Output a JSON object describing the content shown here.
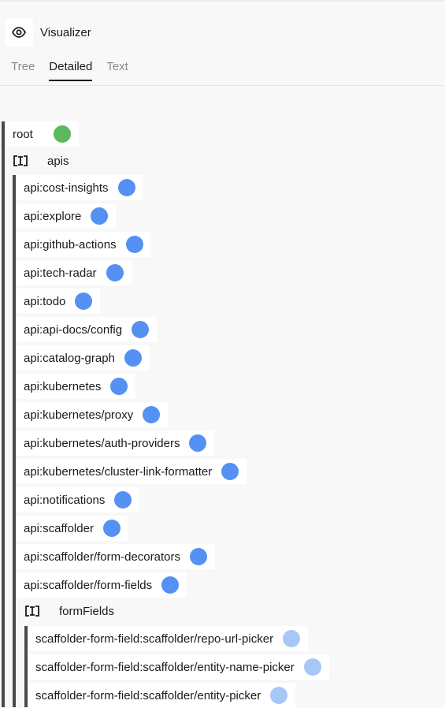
{
  "app": {
    "title": "Visualizer",
    "title_icon": "eye-icon"
  },
  "tabs": [
    {
      "label": "Tree",
      "active": false
    },
    {
      "label": "Detailed",
      "active": true
    },
    {
      "label": "Text",
      "active": false
    }
  ],
  "colors": {
    "root_dot": "#5cb85c",
    "api_dot": "#5591f2",
    "field_dot": "#a7c8f7"
  },
  "tree": {
    "root": {
      "label": "root"
    },
    "apis_group": {
      "label": "apis",
      "icon": "input-attachment-icon"
    },
    "apis": [
      "api:cost-insights",
      "api:explore",
      "api:github-actions",
      "api:tech-radar",
      "api:todo",
      "api:api-docs/config",
      "api:catalog-graph",
      "api:kubernetes",
      "api:kubernetes/proxy",
      "api:kubernetes/auth-providers",
      "api:kubernetes/cluster-link-formatter",
      "api:notifications",
      "api:scaffolder",
      "api:scaffolder/form-decorators",
      "api:scaffolder/form-fields"
    ],
    "formfields_group": {
      "label": "formFields",
      "icon": "input-attachment-icon"
    },
    "form_fields": [
      "scaffolder-form-field:scaffolder/repo-url-picker",
      "scaffolder-form-field:scaffolder/entity-name-picker",
      "scaffolder-form-field:scaffolder/entity-picker"
    ]
  }
}
